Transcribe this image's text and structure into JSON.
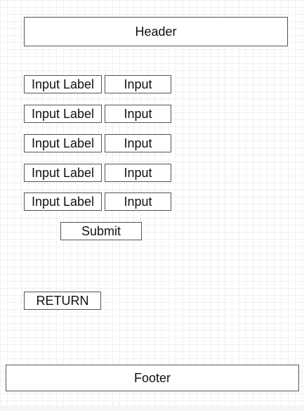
{
  "header": {
    "label": "Header"
  },
  "form": {
    "rows": [
      {
        "label": "Input Label",
        "input": "Input"
      },
      {
        "label": "Input Label",
        "input": "Input"
      },
      {
        "label": "Input Label",
        "input": "Input"
      },
      {
        "label": "Input Label",
        "input": "Input"
      },
      {
        "label": "Input Label",
        "input": "Input"
      }
    ],
    "submit_label": "Submit"
  },
  "return_label": "RETURN",
  "footer": {
    "label": "Footer"
  }
}
